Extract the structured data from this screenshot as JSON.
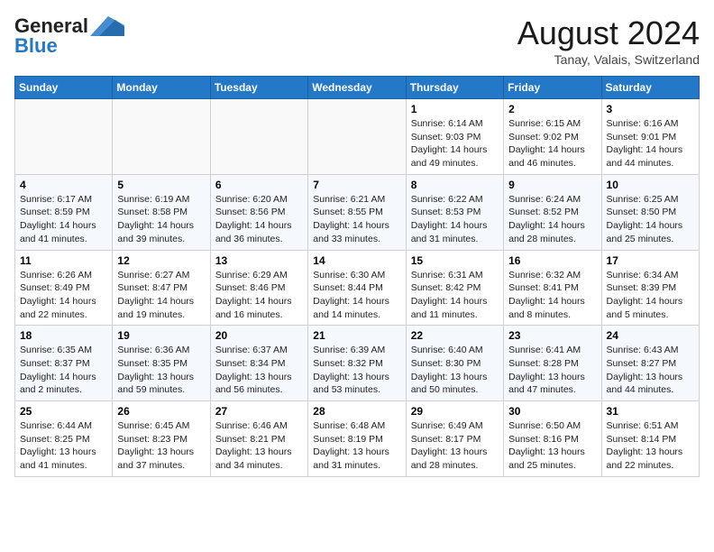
{
  "logo": {
    "general": "General",
    "blue": "Blue"
  },
  "title": "August 2024",
  "location": "Tanay, Valais, Switzerland",
  "weekdays": [
    "Sunday",
    "Monday",
    "Tuesday",
    "Wednesday",
    "Thursday",
    "Friday",
    "Saturday"
  ],
  "weeks": [
    [
      {
        "day": "",
        "info": ""
      },
      {
        "day": "",
        "info": ""
      },
      {
        "day": "",
        "info": ""
      },
      {
        "day": "",
        "info": ""
      },
      {
        "day": "1",
        "info": "Sunrise: 6:14 AM\nSunset: 9:03 PM\nDaylight: 14 hours\nand 49 minutes."
      },
      {
        "day": "2",
        "info": "Sunrise: 6:15 AM\nSunset: 9:02 PM\nDaylight: 14 hours\nand 46 minutes."
      },
      {
        "day": "3",
        "info": "Sunrise: 6:16 AM\nSunset: 9:01 PM\nDaylight: 14 hours\nand 44 minutes."
      }
    ],
    [
      {
        "day": "4",
        "info": "Sunrise: 6:17 AM\nSunset: 8:59 PM\nDaylight: 14 hours\nand 41 minutes."
      },
      {
        "day": "5",
        "info": "Sunrise: 6:19 AM\nSunset: 8:58 PM\nDaylight: 14 hours\nand 39 minutes."
      },
      {
        "day": "6",
        "info": "Sunrise: 6:20 AM\nSunset: 8:56 PM\nDaylight: 14 hours\nand 36 minutes."
      },
      {
        "day": "7",
        "info": "Sunrise: 6:21 AM\nSunset: 8:55 PM\nDaylight: 14 hours\nand 33 minutes."
      },
      {
        "day": "8",
        "info": "Sunrise: 6:22 AM\nSunset: 8:53 PM\nDaylight: 14 hours\nand 31 minutes."
      },
      {
        "day": "9",
        "info": "Sunrise: 6:24 AM\nSunset: 8:52 PM\nDaylight: 14 hours\nand 28 minutes."
      },
      {
        "day": "10",
        "info": "Sunrise: 6:25 AM\nSunset: 8:50 PM\nDaylight: 14 hours\nand 25 minutes."
      }
    ],
    [
      {
        "day": "11",
        "info": "Sunrise: 6:26 AM\nSunset: 8:49 PM\nDaylight: 14 hours\nand 22 minutes."
      },
      {
        "day": "12",
        "info": "Sunrise: 6:27 AM\nSunset: 8:47 PM\nDaylight: 14 hours\nand 19 minutes."
      },
      {
        "day": "13",
        "info": "Sunrise: 6:29 AM\nSunset: 8:46 PM\nDaylight: 14 hours\nand 16 minutes."
      },
      {
        "day": "14",
        "info": "Sunrise: 6:30 AM\nSunset: 8:44 PM\nDaylight: 14 hours\nand 14 minutes."
      },
      {
        "day": "15",
        "info": "Sunrise: 6:31 AM\nSunset: 8:42 PM\nDaylight: 14 hours\nand 11 minutes."
      },
      {
        "day": "16",
        "info": "Sunrise: 6:32 AM\nSunset: 8:41 PM\nDaylight: 14 hours\nand 8 minutes."
      },
      {
        "day": "17",
        "info": "Sunrise: 6:34 AM\nSunset: 8:39 PM\nDaylight: 14 hours\nand 5 minutes."
      }
    ],
    [
      {
        "day": "18",
        "info": "Sunrise: 6:35 AM\nSunset: 8:37 PM\nDaylight: 14 hours\nand 2 minutes."
      },
      {
        "day": "19",
        "info": "Sunrise: 6:36 AM\nSunset: 8:35 PM\nDaylight: 13 hours\nand 59 minutes."
      },
      {
        "day": "20",
        "info": "Sunrise: 6:37 AM\nSunset: 8:34 PM\nDaylight: 13 hours\nand 56 minutes."
      },
      {
        "day": "21",
        "info": "Sunrise: 6:39 AM\nSunset: 8:32 PM\nDaylight: 13 hours\nand 53 minutes."
      },
      {
        "day": "22",
        "info": "Sunrise: 6:40 AM\nSunset: 8:30 PM\nDaylight: 13 hours\nand 50 minutes."
      },
      {
        "day": "23",
        "info": "Sunrise: 6:41 AM\nSunset: 8:28 PM\nDaylight: 13 hours\nand 47 minutes."
      },
      {
        "day": "24",
        "info": "Sunrise: 6:43 AM\nSunset: 8:27 PM\nDaylight: 13 hours\nand 44 minutes."
      }
    ],
    [
      {
        "day": "25",
        "info": "Sunrise: 6:44 AM\nSunset: 8:25 PM\nDaylight: 13 hours\nand 41 minutes."
      },
      {
        "day": "26",
        "info": "Sunrise: 6:45 AM\nSunset: 8:23 PM\nDaylight: 13 hours\nand 37 minutes."
      },
      {
        "day": "27",
        "info": "Sunrise: 6:46 AM\nSunset: 8:21 PM\nDaylight: 13 hours\nand 34 minutes."
      },
      {
        "day": "28",
        "info": "Sunrise: 6:48 AM\nSunset: 8:19 PM\nDaylight: 13 hours\nand 31 minutes."
      },
      {
        "day": "29",
        "info": "Sunrise: 6:49 AM\nSunset: 8:17 PM\nDaylight: 13 hours\nand 28 minutes."
      },
      {
        "day": "30",
        "info": "Sunrise: 6:50 AM\nSunset: 8:16 PM\nDaylight: 13 hours\nand 25 minutes."
      },
      {
        "day": "31",
        "info": "Sunrise: 6:51 AM\nSunset: 8:14 PM\nDaylight: 13 hours\nand 22 minutes."
      }
    ]
  ]
}
